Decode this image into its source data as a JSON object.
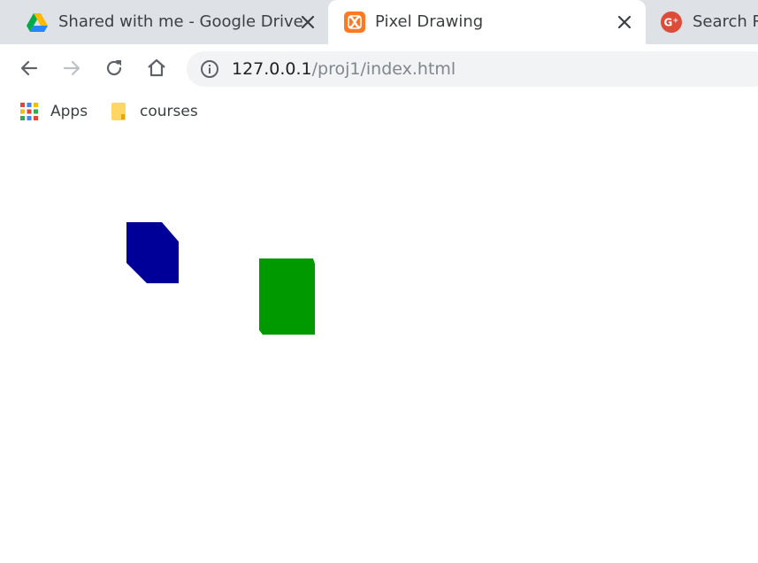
{
  "tabs": [
    {
      "title": "Shared with me - Google Drive",
      "favicon": "google-drive-icon",
      "active": false
    },
    {
      "title": "Pixel Drawing",
      "favicon": "xampp-icon",
      "active": true
    },
    {
      "title": "Search Re",
      "favicon": "google-plus-icon",
      "active": false
    }
  ],
  "toolbar": {
    "url_host": "127.0.0.1",
    "url_path": "/proj1/index.html"
  },
  "bookmarks": [
    {
      "label": "Apps",
      "icon": "apps-grid-icon"
    },
    {
      "label": "courses",
      "icon": "folder-icon"
    }
  ],
  "canvas": {
    "shapes": [
      {
        "name": "blue-octagon-shape",
        "color": "#000099"
      },
      {
        "name": "green-rectangle-shape",
        "color": "#009900"
      }
    ]
  }
}
